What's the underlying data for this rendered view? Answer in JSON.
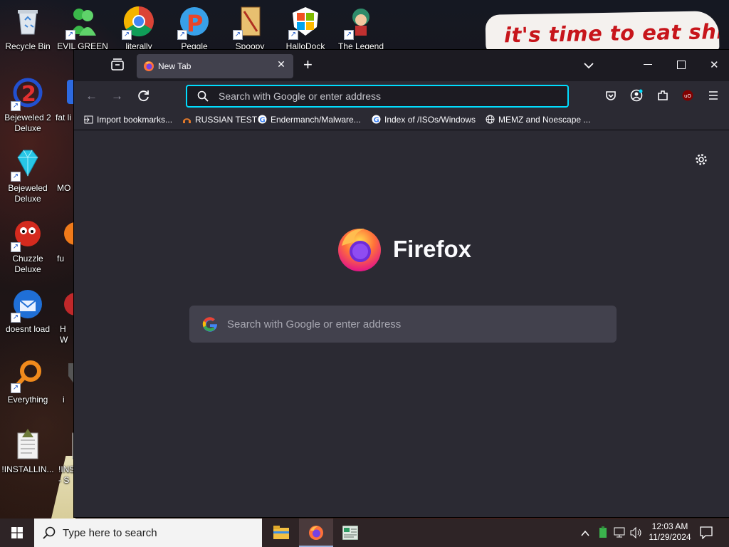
{
  "desktop": {
    "banner_text": "it's time to eat shit",
    "icons": [
      {
        "label": "Recycle Bin",
        "icon": "recycle-bin-icon"
      },
      {
        "label": "EVIL GREEN ME",
        "icon": "messenger-people-icon"
      },
      {
        "label": "literally",
        "icon": "chrome-icon"
      },
      {
        "label": "Peggle Nights",
        "icon": "peggle-icon"
      },
      {
        "label": "Spoopy",
        "icon": "spoopy-icon"
      },
      {
        "label": "HalloDock",
        "icon": "windows-logo-icon"
      },
      {
        "label": "The Legend",
        "icon": "legend-character-icon"
      },
      {
        "label": "Bejeweled 2 Deluxe",
        "icon": "bejeweled2-icon"
      },
      {
        "label": "fat li",
        "icon": "blue-app-icon"
      },
      {
        "label": "Bejeweled Deluxe",
        "icon": "diamond-icon"
      },
      {
        "label": "MO",
        "icon": "unknown-app-icon"
      },
      {
        "label": "Chuzzle Deluxe",
        "icon": "chuzzle-icon"
      },
      {
        "label": "fu",
        "icon": "orange-app-icon"
      },
      {
        "label": "doesnt load",
        "icon": "thunderbird-icon"
      },
      {
        "label": "H W",
        "icon": "red-app-icon"
      },
      {
        "label": "Everything",
        "icon": "everything-search-icon"
      },
      {
        "label": "i",
        "icon": "shield-app-icon"
      },
      {
        "label": "!INSTALLIN...",
        "icon": "text-file-icon"
      },
      {
        "label": "!INS - S",
        "icon": "text-file-icon"
      }
    ]
  },
  "browser": {
    "tab_title": "New Tab",
    "url_placeholder": "Search with Google or enter address",
    "bookmarks": [
      {
        "label": "Import bookmarks...",
        "icon": "import-icon"
      },
      {
        "label": "RUSSIAN TEST",
        "icon": "headphones-favicon"
      },
      {
        "label": "Endermanch/Malware...",
        "icon": "google-favicon"
      },
      {
        "label": "Index of /ISOs/Windows",
        "icon": "google-favicon"
      },
      {
        "label": "MEMZ and Noescape ...",
        "icon": "globe-favicon"
      }
    ],
    "logo_text": "Firefox",
    "search_placeholder": "Search with Google or enter address",
    "colors": {
      "url_focus_ring": "#00ddff",
      "chrome_bg": "#2b2a33",
      "tab_active": "#42414d"
    }
  },
  "taskbar": {
    "search_placeholder": "Type here to search",
    "time": "12:03 AM",
    "date": "11/29/2024",
    "pinned": [
      "file-explorer-icon",
      "firefox-icon",
      "terminal-app-icon"
    ]
  }
}
